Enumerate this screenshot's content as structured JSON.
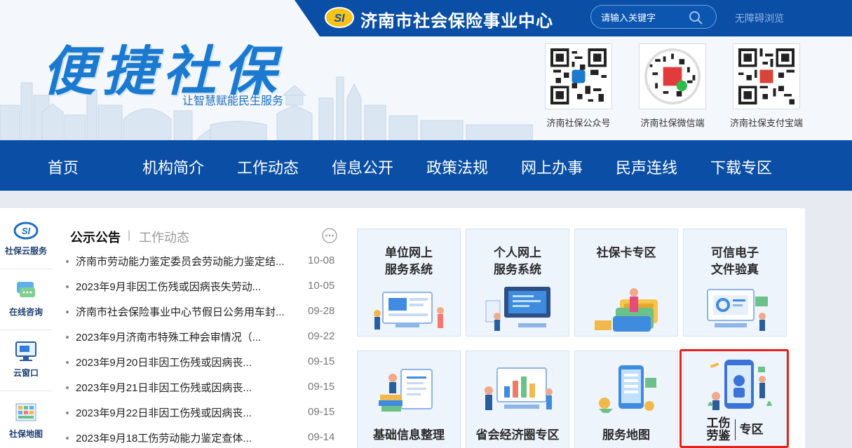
{
  "header": {
    "brand_title": "济南市社会保险事业中心",
    "brand_logo_text": "SI",
    "search_placeholder": "请输入关键字",
    "accessibility_link": "无障碍浏览",
    "slogan": "便捷社保",
    "subslogan": "让智慧赋能民生服务",
    "qr_codes": [
      {
        "label": "济南社保公众号",
        "icon": "qr-code-icon"
      },
      {
        "label": "济南社保微信端",
        "icon": "qr-code-icon"
      },
      {
        "label": "济南社保支付宝端",
        "icon": "qr-code-icon"
      }
    ]
  },
  "nav": {
    "items": [
      "首页",
      "机构简介",
      "工作动态",
      "信息公开",
      "政策法规",
      "网上办事",
      "民声连线",
      "下载专区"
    ]
  },
  "sidebar": {
    "items": [
      {
        "label": "社保云服务",
        "icon": "cloud-service-icon"
      },
      {
        "label": "在线咨询",
        "icon": "chat-icon"
      },
      {
        "label": "云窗口",
        "icon": "monitor-icon"
      },
      {
        "label": "社保地图",
        "icon": "map-icon"
      }
    ]
  },
  "news": {
    "tab_active": "公示公告",
    "tab_separator": "|",
    "tab_inactive": "工作动态",
    "items": [
      {
        "title": "济南市劳动能力鉴定委员会劳动能力鉴定结...",
        "date": "10-08"
      },
      {
        "title": "2023年9月非因工伤残或因病丧失劳动...",
        "date": "10-05"
      },
      {
        "title": "济南市社会保险事业中心节假日公务用车封...",
        "date": "09-28"
      },
      {
        "title": "2023年9月济南市特殊工种会审情况（...",
        "date": "09-22"
      },
      {
        "title": "2023年9月20日非因工伤残或因病丧...",
        "date": "09-15"
      },
      {
        "title": "2023年9月21日非因工伤残或因病丧...",
        "date": "09-15"
      },
      {
        "title": "2023年9月22日非因工伤残或因病丧...",
        "date": "09-15"
      },
      {
        "title": "2023年9月18工伤劳动能力鉴定查体...",
        "date": "09-14"
      }
    ]
  },
  "tiles": {
    "unit_online": {
      "line1": "单位网上",
      "line2": "服务系统"
    },
    "personal_online": {
      "line1": "个人网上",
      "line2": "服务系统"
    },
    "social_card": {
      "line1": "社保卡专区"
    },
    "e_file": {
      "line1": "可信电子",
      "line2": "文件验真"
    },
    "basic_info": {
      "line1": "基础信息整理"
    },
    "economic_circle": {
      "line1": "省会经济圈专区"
    },
    "service_map": {
      "line1": "服务地图"
    },
    "injury_zone": {
      "line1a": "工伤",
      "line1b": "劳鉴",
      "line2": "专区"
    }
  }
}
